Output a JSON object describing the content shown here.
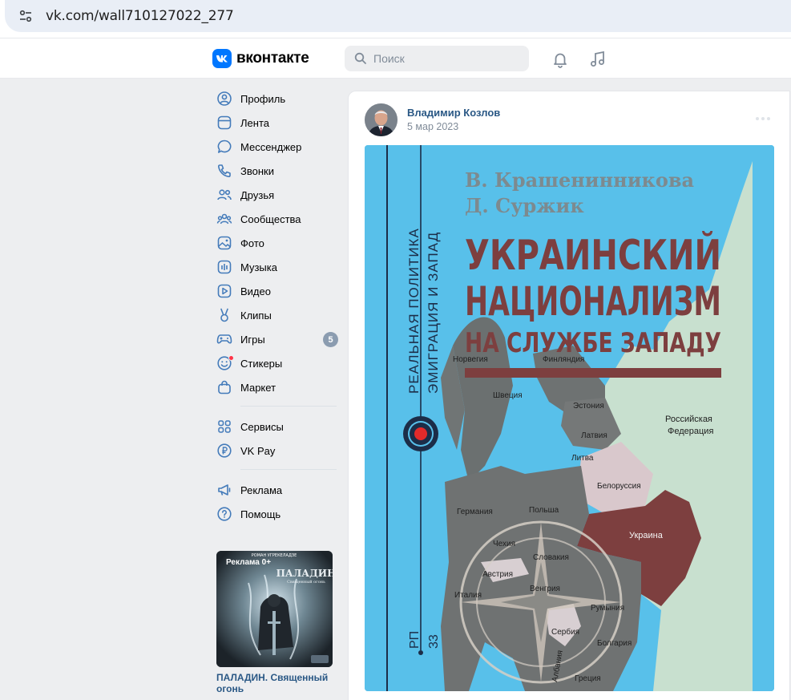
{
  "browser": {
    "url": "vk.com/wall710127022_277"
  },
  "header": {
    "logo_text": "вконтакте",
    "search_placeholder": "Поиск",
    "accent_color": "#0077ff"
  },
  "nav": {
    "items": [
      {
        "label": "Профиль",
        "icon": "profile-icon"
      },
      {
        "label": "Лента",
        "icon": "feed-icon"
      },
      {
        "label": "Мессенджер",
        "icon": "messenger-icon"
      },
      {
        "label": "Звонки",
        "icon": "phone-icon"
      },
      {
        "label": "Друзья",
        "icon": "friends-icon"
      },
      {
        "label": "Сообщества",
        "icon": "communities-icon"
      },
      {
        "label": "Фото",
        "icon": "photo-icon"
      },
      {
        "label": "Музыка",
        "icon": "music-icon"
      },
      {
        "label": "Видео",
        "icon": "video-icon"
      },
      {
        "label": "Клипы",
        "icon": "clips-icon"
      },
      {
        "label": "Игры",
        "icon": "games-icon",
        "badge": "5"
      },
      {
        "label": "Стикеры",
        "icon": "stickers-icon"
      },
      {
        "label": "Маркет",
        "icon": "market-icon"
      }
    ],
    "secondary": [
      {
        "label": "Сервисы",
        "icon": "services-icon"
      },
      {
        "label": "VK Pay",
        "icon": "vkpay-icon"
      }
    ],
    "tertiary": [
      {
        "label": "Реклама",
        "icon": "ads-icon"
      },
      {
        "label": "Помощь",
        "icon": "help-icon"
      }
    ]
  },
  "ad": {
    "tag": "Реклама 0+",
    "title": "ПАЛАДИН. Священный огонь",
    "image_text_top": "РОМАН УГРЕКЕЛАДЗЕ",
    "image_text_title": "ПАЛАДИН",
    "image_text_sub": "Священный огонь"
  },
  "post": {
    "author": "Владимир Козлов",
    "date": "5 мар 2023",
    "cover": {
      "author1": "В. Крашенинникова",
      "author2": "Д. Суржик",
      "title1": "УКРАИНСКИЙ",
      "title2": "НАЦИОНАЛИЗМ",
      "title3": "НА СЛУЖБЕ ЗАПАДУ",
      "series1": "РЕАЛЬНАЯ ПОЛИТИКА",
      "series2": "ЭМИГРАЦИЯ И ЗАПАД",
      "code1": "РП",
      "code2": "33",
      "countries": {
        "norway": "Норвегия",
        "finland": "Финляндия",
        "sweden": "Швеция",
        "estonia": "Эстония",
        "russia1": "Российская",
        "russia2": "Федерация",
        "latvia": "Латвия",
        "lithuania": "Литва",
        "belarus": "Белоруссия",
        "germany": "Германия",
        "poland": "Польша",
        "ukraine": "Украина",
        "czech": "Чехия",
        "slovakia": "Словакия",
        "austria": "Австрия",
        "hungary": "Венгрия",
        "italy": "Италия",
        "romania": "Румыния",
        "serbia": "Сербия",
        "bulgaria": "Болгария",
        "albania": "Албания",
        "greece": "Греция"
      }
    }
  }
}
